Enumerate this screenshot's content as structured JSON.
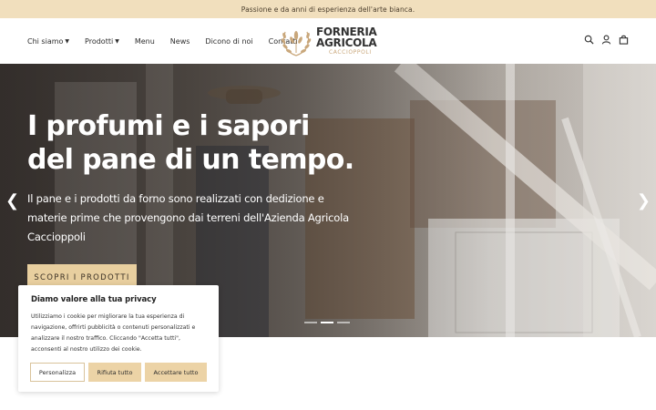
{
  "topbar": {
    "text": "Passione e da anni di esperienza dell'arte bianca."
  },
  "nav": {
    "items": [
      {
        "label": "Chi siamo",
        "has_dropdown": true
      },
      {
        "label": "Prodotti",
        "has_dropdown": true
      },
      {
        "label": "Menu",
        "has_dropdown": false
      },
      {
        "label": "News",
        "has_dropdown": false
      },
      {
        "label": "Dicono di noi",
        "has_dropdown": false
      },
      {
        "label": "Contatti",
        "has_dropdown": false
      }
    ]
  },
  "logo": {
    "line1": "FORNERIA",
    "line2": "AGRICOLA",
    "sub": "CACCIOPPOLI"
  },
  "header_icons": [
    "search-icon",
    "user-icon",
    "bag-icon"
  ],
  "hero": {
    "title": "I profumi e i sapori del pane di un tempo.",
    "text": "Il pane e i prodotti da forno sono realizzati con dedizione e materie prime che provengono dai terreni dell'Azienda Agricola Caccioppoli",
    "button": "SCOPRI I PRODOTTI",
    "slides": 3,
    "active_slide": 2
  },
  "cookie": {
    "title": "Diamo valore alla tua privacy",
    "text": "Utilizziamo i cookie per migliorare la tua esperienza di navigazione, offrirti pubblicità o contenuti personalizzati e analizzare il nostro traffico. Cliccando \"Accetta tutti\", acconsenti al nostro utilizzo dei cookie.",
    "btn_customize": "Personalizza",
    "btn_reject": "Rifiuta tutto",
    "btn_accept": "Accettare tutto"
  },
  "colors": {
    "topbar_bg": "#f1dfbd",
    "accent": "#e8cf9f",
    "logo_gold": "#c9a77b"
  }
}
